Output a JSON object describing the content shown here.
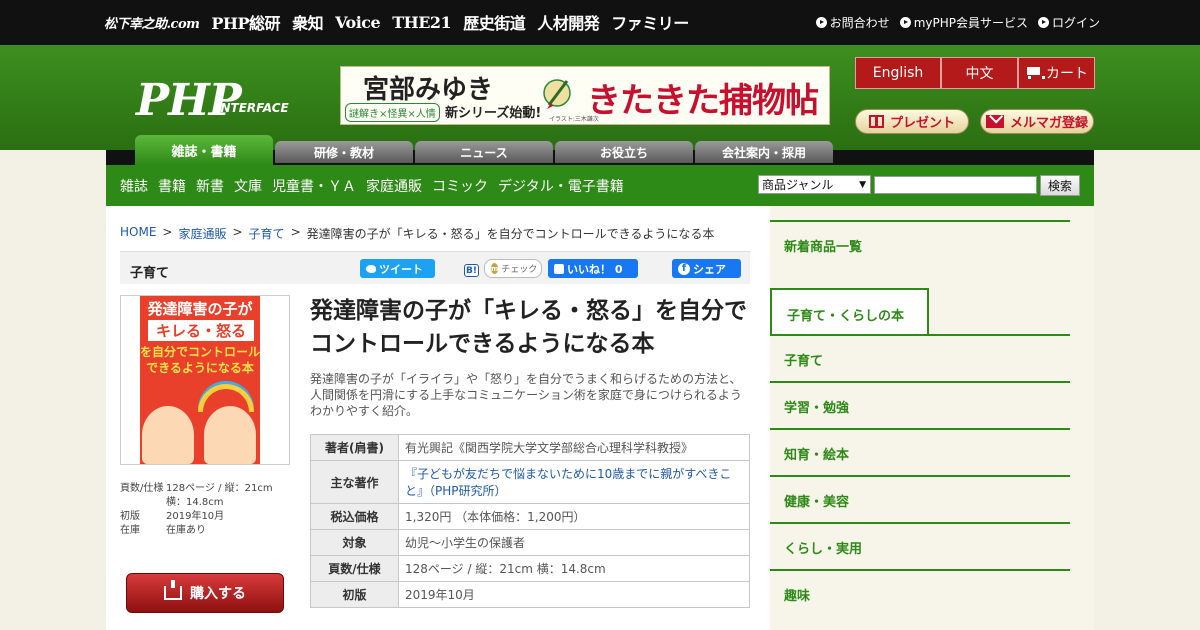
{
  "topbar": {
    "brands": [
      "松下幸之助.com",
      "PHP総研",
      "衆知",
      "Voice",
      "THE21",
      "歴史街道",
      "人材開発",
      "ファミリー"
    ],
    "utility": [
      "お問合わせ",
      "myPHP会員サービス",
      "ログイン"
    ]
  },
  "header": {
    "logo": "PHP",
    "logo_sub": "INTERFACE",
    "banner": {
      "author": "宮部みゆき",
      "tag": "謎解き×怪異×人情",
      "tagline": "新シリーズ始動!",
      "title": "きたきた捕物帖",
      "credit": "イラスト:三木謙次"
    },
    "lang": [
      "English",
      "中文",
      "カート"
    ],
    "present": "プレゼント",
    "mailmag": "メルマガ登録"
  },
  "tabs": [
    "雑誌・書籍",
    "研修・教材",
    "ニュース",
    "お役立ち",
    "会社案内・採用"
  ],
  "subnav": {
    "items": [
      "雑誌",
      "書籍",
      "新書",
      "文庫",
      "児童書・ＹＡ",
      "家庭通販",
      "コミック",
      "デジタル・電子書籍"
    ],
    "genre": "商品ジャンル",
    "search_placeholder": "",
    "search_button": "検索"
  },
  "breadcrumb": {
    "home": "HOME",
    "sep": ">",
    "cat1": "家庭通販",
    "cat2": "子育て",
    "current": "発達障害の子が「キレる・怒る」を自分でコントロールできるようになる本"
  },
  "catbar": {
    "label": "子育て",
    "tweet": "ツイート",
    "hatena": "B!",
    "mixi": "チェック",
    "like": "いいね！ 0",
    "share": "シェア"
  },
  "cover": {
    "line1": "発達障害の子が",
    "line2": "キレる・怒る",
    "line3a": "を自分でコントロール",
    "line3b": "できるようになる本"
  },
  "meta": [
    {
      "k": "頁数/仕様",
      "v": "128ページ / 縦：21cm 横：14.8cm"
    },
    {
      "k": "初版",
      "v": "2019年10月"
    },
    {
      "k": "在庫",
      "v": "在庫あり"
    }
  ],
  "buy_label": "購入する",
  "book": {
    "title": "発達障害の子が「キレる・怒る」を自分でコントロールできるようになる本",
    "description": "発達障害の子が「イライラ」や「怒り」を自分でうまく和らげるための方法と、人間関係を円滑にする上手なコミュニケーション術を家庭で身につけられるようわかりやすく紹介。",
    "spec": [
      {
        "k": "著者(肩書)",
        "v": "有光興記《関西学院大学文学部総合心理科学科教授》"
      },
      {
        "k": "主な著作",
        "v": "『子どもが友だちで悩まないために10歳までに親がすべきこと』（PHP研究所）"
      },
      {
        "k": "税込価格",
        "v": "1,320円 （本体価格：1,200円）"
      },
      {
        "k": "対象",
        "v": "幼児～小学生の保護者"
      },
      {
        "k": "頁数/仕様",
        "v": "128ページ / 縦：21cm 横：14.8cm"
      },
      {
        "k": "初版",
        "v": "2019年10月"
      }
    ]
  },
  "sidebar": [
    "新着商品一覧",
    "子育て・くらしの本",
    "子育て",
    "学習・勉強",
    "知育・絵本",
    "健康・美容",
    "くらし・実用",
    "趣味"
  ]
}
